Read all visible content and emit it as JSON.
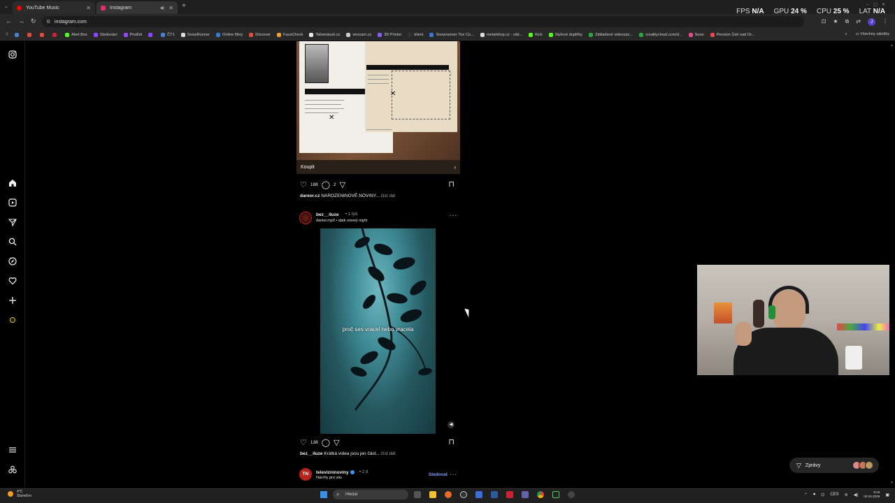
{
  "browser": {
    "tabs": [
      {
        "label": "YouTube Music",
        "color": "#ff0000"
      },
      {
        "label": "Instagram",
        "color": "#e1306c"
      }
    ],
    "url": "instagram.com",
    "bookmarks": [
      {
        "label": "Alert Box",
        "color": "#53fc18"
      },
      {
        "label": "Sledování",
        "color": "#9146ff"
      },
      {
        "label": "Prošlot",
        "color": "#9146ff"
      },
      {
        "label": "ČT1",
        "color": "#4a7fd4"
      },
      {
        "label": "SnowRunner",
        "color": "#dddddd"
      },
      {
        "label": "Online filmy",
        "color": "#3a7bd5"
      },
      {
        "label": "Discover",
        "color": "#e34b3b"
      },
      {
        "label": "FaceCheck",
        "color": "#f0a030"
      },
      {
        "label": "Talismánek.cz",
        "color": "#e8e8e8"
      },
      {
        "label": "worcam.cz",
        "color": "#cccccc"
      },
      {
        "label": "3D Printer",
        "color": "#8b5cf6"
      },
      {
        "label": "klient",
        "color": "#333333"
      },
      {
        "label": "Snowrunner Tire Co...",
        "color": "#3d78d8"
      },
      {
        "label": "metalshop.cz - váš...",
        "color": "#dddddd"
      },
      {
        "label": "Kick",
        "color": "#53fc18"
      },
      {
        "label": "Stylové doplňky",
        "color": "#53fc18"
      },
      {
        "label": "Základové videozáz...",
        "color": "#27a844"
      },
      {
        "label": "crealitycloud.com/d...",
        "color": "#27a844"
      },
      {
        "label": "Suno",
        "color": "#e64a8a"
      },
      {
        "label": "Penzion Ústí nad Or...",
        "color": "#e64a4a"
      }
    ],
    "all_bookmarks": "Všechny záložky"
  },
  "overlay_stats": [
    {
      "label": "FPS",
      "value": "N/A"
    },
    {
      "label": "GPU",
      "value": "24 %"
    },
    {
      "label": "CPU",
      "value": "25 %"
    },
    {
      "label": "LAT",
      "value": "N/A"
    }
  ],
  "post1": {
    "buy_label": "Koupit",
    "likes": "188",
    "comments": "2",
    "caption_user": "dareor.cz",
    "caption_text": "NAROZENINOVÉ NOVINY...",
    "more": "číst dál"
  },
  "post2": {
    "username": "bez__iluze",
    "time": "• 1 týd.",
    "audio": "daniel.mp3 • dark snowy night",
    "subtitle": "proč ses vracel nebo vracela",
    "likes": "138",
    "caption_user": "bez__iluze",
    "caption_text": "Krátká videa jsou jen část...",
    "more": "číst dál"
  },
  "post3": {
    "avatar_text": "TN",
    "username": "televizninoviny",
    "time": "• 2 d",
    "suggestion": "Návrhy pro vás",
    "follow": "Sledovat"
  },
  "messages_label": "Zprávy",
  "taskbar": {
    "weather_temp": "4°C",
    "weather_desc": "Slunečno",
    "search_placeholder": "Hledat",
    "lang": "CES",
    "time": "9:15",
    "date": "03.03.2026"
  }
}
